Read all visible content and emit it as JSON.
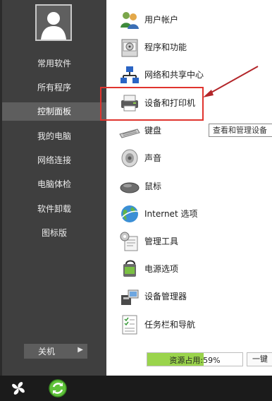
{
  "sidebar": {
    "items": [
      {
        "label": "常用软件"
      },
      {
        "label": "所有程序"
      },
      {
        "label": "控制面板",
        "selected": true
      },
      {
        "label": "我的电脑"
      },
      {
        "label": "网络连接"
      },
      {
        "label": "电脑体检"
      },
      {
        "label": "软件卸载"
      },
      {
        "label": "图标版"
      }
    ],
    "shutdown_label": "关机",
    "shutdown_arrow_icon": "triangle-right-icon"
  },
  "control_panel": {
    "items": [
      {
        "label": "用户帐户",
        "icon": "users-icon"
      },
      {
        "label": "程序和功能",
        "icon": "programs-icon"
      },
      {
        "label": "网络和共享中心",
        "icon": "network-icon"
      },
      {
        "label": "设备和打印机",
        "icon": "printer-icon",
        "highlighted": true
      },
      {
        "label": "键盘",
        "icon": "keyboard-icon"
      },
      {
        "label": "声音",
        "icon": "speaker-icon"
      },
      {
        "label": "鼠标",
        "icon": "mouse-icon"
      },
      {
        "label": "Internet 选项",
        "icon": "globe-icon"
      },
      {
        "label": "管理工具",
        "icon": "admin-tools-icon"
      },
      {
        "label": "电源选项",
        "icon": "power-icon"
      },
      {
        "label": "设备管理器",
        "icon": "device-manager-icon"
      },
      {
        "label": "任务栏和导航",
        "icon": "taskbar-nav-icon"
      }
    ]
  },
  "tooltip": {
    "text": "查看和管理设备"
  },
  "resource_usage": {
    "label": "资源占用:59%",
    "percent": 59
  },
  "one_key_label": "一键",
  "colors": {
    "sidebar_bg": "#3f3f3f",
    "selected_bg": "#5e5e5e",
    "annotation_red": "#e0342e",
    "usage_green": "#9ad44c"
  }
}
